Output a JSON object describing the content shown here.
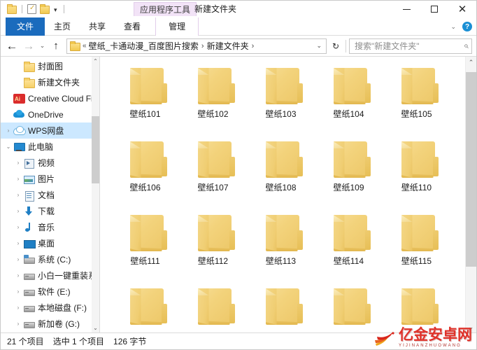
{
  "window": {
    "context_tab_badge": "应用程序工具",
    "title": "新建文件夹",
    "minimize_label": "最小化",
    "maximize_label": "最大化",
    "close_label": "关闭",
    "accent_blue": "#1a6bbd",
    "context_purple": "#f2e3f7"
  },
  "quick_access": {
    "items": [
      {
        "name": "folder-icon",
        "label": "属性"
      },
      {
        "name": "properties-icon",
        "label": "属性"
      },
      {
        "name": "new-folder-icon",
        "label": "新建文件夹"
      }
    ],
    "dropdown_caret": "▾"
  },
  "ribbon": {
    "tabs": [
      {
        "label": "文件",
        "selected": true,
        "kind": "file"
      },
      {
        "label": "主页",
        "selected": false,
        "kind": "normal"
      },
      {
        "label": "共享",
        "selected": false,
        "kind": "normal"
      },
      {
        "label": "查看",
        "selected": false,
        "kind": "normal"
      },
      {
        "label": "管理",
        "selected": false,
        "kind": "contextual"
      }
    ],
    "collapse_caret": "⌄",
    "help_glyph": "?"
  },
  "address_bar": {
    "back_glyph": "←",
    "forward_glyph": "→",
    "recent_glyph": "⌄",
    "up_glyph": "↑",
    "separator_double": "«",
    "separator_single": "›",
    "crumbs": [
      {
        "label": "壁纸_卡通动漫_百度图片搜索"
      },
      {
        "label": "新建文件夹"
      }
    ],
    "dropdown_glyph": "⌄",
    "refresh_glyph": "↻",
    "search_placeholder": "搜索\"新建文件夹\"",
    "search_value": "",
    "search_icon_glyph": "⌕"
  },
  "sidebar": {
    "items": [
      {
        "label": "封面图",
        "icon": "folder-icon",
        "indent": 2,
        "chevron": "",
        "selected": false
      },
      {
        "label": "新建文件夹",
        "icon": "folder-icon",
        "indent": 2,
        "chevron": "",
        "selected": false
      },
      {
        "label": "Creative Cloud Fil",
        "icon": "creative-cloud-icon",
        "indent": 1,
        "chevron": "",
        "selected": false
      },
      {
        "label": "OneDrive",
        "icon": "onedrive-icon",
        "indent": 1,
        "chevron": "",
        "selected": false
      },
      {
        "label": "WPS网盘",
        "icon": "wps-cloud-icon",
        "indent": 1,
        "chevron": "›",
        "selected": true
      },
      {
        "label": "此电脑",
        "icon": "this-pc-icon",
        "indent": 1,
        "chevron": "⌄",
        "selected": false
      },
      {
        "label": "视频",
        "icon": "video-icon",
        "indent": 2,
        "chevron": "›",
        "selected": false
      },
      {
        "label": "图片",
        "icon": "pictures-icon",
        "indent": 2,
        "chevron": "›",
        "selected": false
      },
      {
        "label": "文档",
        "icon": "documents-icon",
        "indent": 2,
        "chevron": "›",
        "selected": false
      },
      {
        "label": "下载",
        "icon": "downloads-icon",
        "indent": 2,
        "chevron": "›",
        "selected": false
      },
      {
        "label": "音乐",
        "icon": "music-icon",
        "indent": 2,
        "chevron": "›",
        "selected": false
      },
      {
        "label": "桌面",
        "icon": "desktop-icon",
        "indent": 2,
        "chevron": "›",
        "selected": false
      },
      {
        "label": "系统 (C:)",
        "icon": "system-drive-icon",
        "indent": 2,
        "chevron": "›",
        "selected": false
      },
      {
        "label": "小白一键重装系统",
        "icon": "drive-icon",
        "indent": 2,
        "chevron": "›",
        "selected": false
      },
      {
        "label": "软件 (E:)",
        "icon": "drive-icon",
        "indent": 2,
        "chevron": "›",
        "selected": false
      },
      {
        "label": "本地磁盘 (F:)",
        "icon": "drive-icon",
        "indent": 2,
        "chevron": "›",
        "selected": false
      },
      {
        "label": "新加卷 (G:)",
        "icon": "drive-icon",
        "indent": 2,
        "chevron": "›",
        "selected": false
      }
    ],
    "scroll_up_glyph": "⌃",
    "scroll_down_glyph": "⌄"
  },
  "content": {
    "items": [
      {
        "label": "壁纸101"
      },
      {
        "label": "壁纸102"
      },
      {
        "label": "壁纸103"
      },
      {
        "label": "壁纸104"
      },
      {
        "label": "壁纸105"
      },
      {
        "label": "壁纸106"
      },
      {
        "label": "壁纸107"
      },
      {
        "label": "壁纸108"
      },
      {
        "label": "壁纸109"
      },
      {
        "label": "壁纸110"
      },
      {
        "label": "壁纸111"
      },
      {
        "label": "壁纸112"
      },
      {
        "label": "壁纸113"
      },
      {
        "label": "壁纸114"
      },
      {
        "label": "壁纸115"
      },
      {
        "label": ""
      },
      {
        "label": ""
      },
      {
        "label": ""
      },
      {
        "label": ""
      },
      {
        "label": ""
      }
    ],
    "scroll_up_glyph": "⌃",
    "scroll_down_glyph": "⌄"
  },
  "status_bar": {
    "item_count": "21 个项目",
    "selection": "选中 1 个项目",
    "size": "126 字节"
  },
  "watermark": {
    "main": "亿金安卓网",
    "sub": "YIJINANZHUOWANG",
    "color": "#e0322a"
  }
}
